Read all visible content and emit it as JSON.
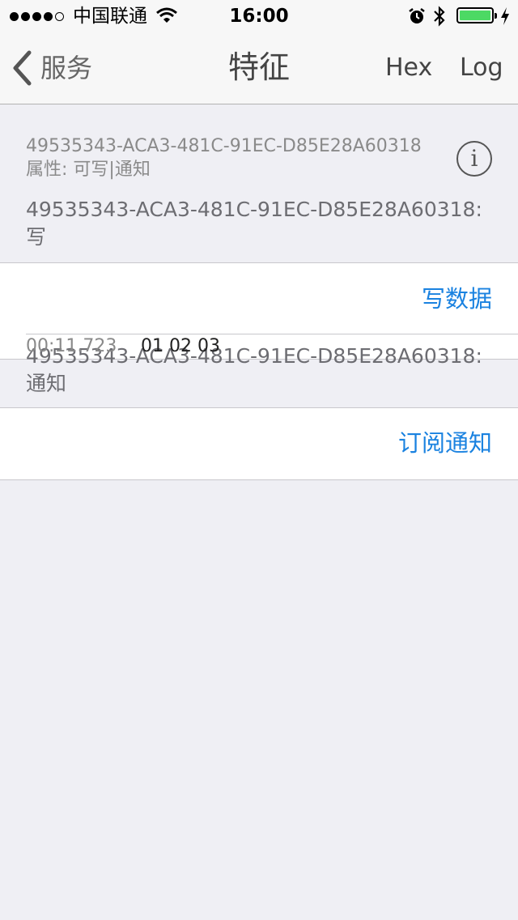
{
  "status_bar": {
    "carrier": "中国联通",
    "time": "16:00",
    "signal_filled": 4,
    "signal_total": 5,
    "battery_level": 1.0,
    "battery_color": "#4cd964",
    "icons": [
      "wifi-icon",
      "alarm-icon",
      "bluetooth-icon",
      "battery-icon",
      "charging-icon"
    ]
  },
  "nav": {
    "back_label": "服务",
    "title": "特征",
    "hex_label": "Hex",
    "log_label": "Log"
  },
  "characteristic": {
    "uuid": "49535343-ACA3-481C-91EC-D85E28A60318",
    "properties": "属性: 可写|通知"
  },
  "write_section": {
    "header_line1": "49535343-ACA3-481C-91EC-D85E28A60318:",
    "header_line2": "写",
    "action_label": "写数据",
    "log_time": "00:11.723",
    "log_data": "01 02 03"
  },
  "notify_section": {
    "header_line1": "49535343-ACA3-481C-91EC-D85E28A60318:",
    "header_line2": "通知",
    "action_label": "订阅通知"
  },
  "colors": {
    "accent": "#1a82e0",
    "background": "#efeff4",
    "nav_text": "#444444"
  }
}
